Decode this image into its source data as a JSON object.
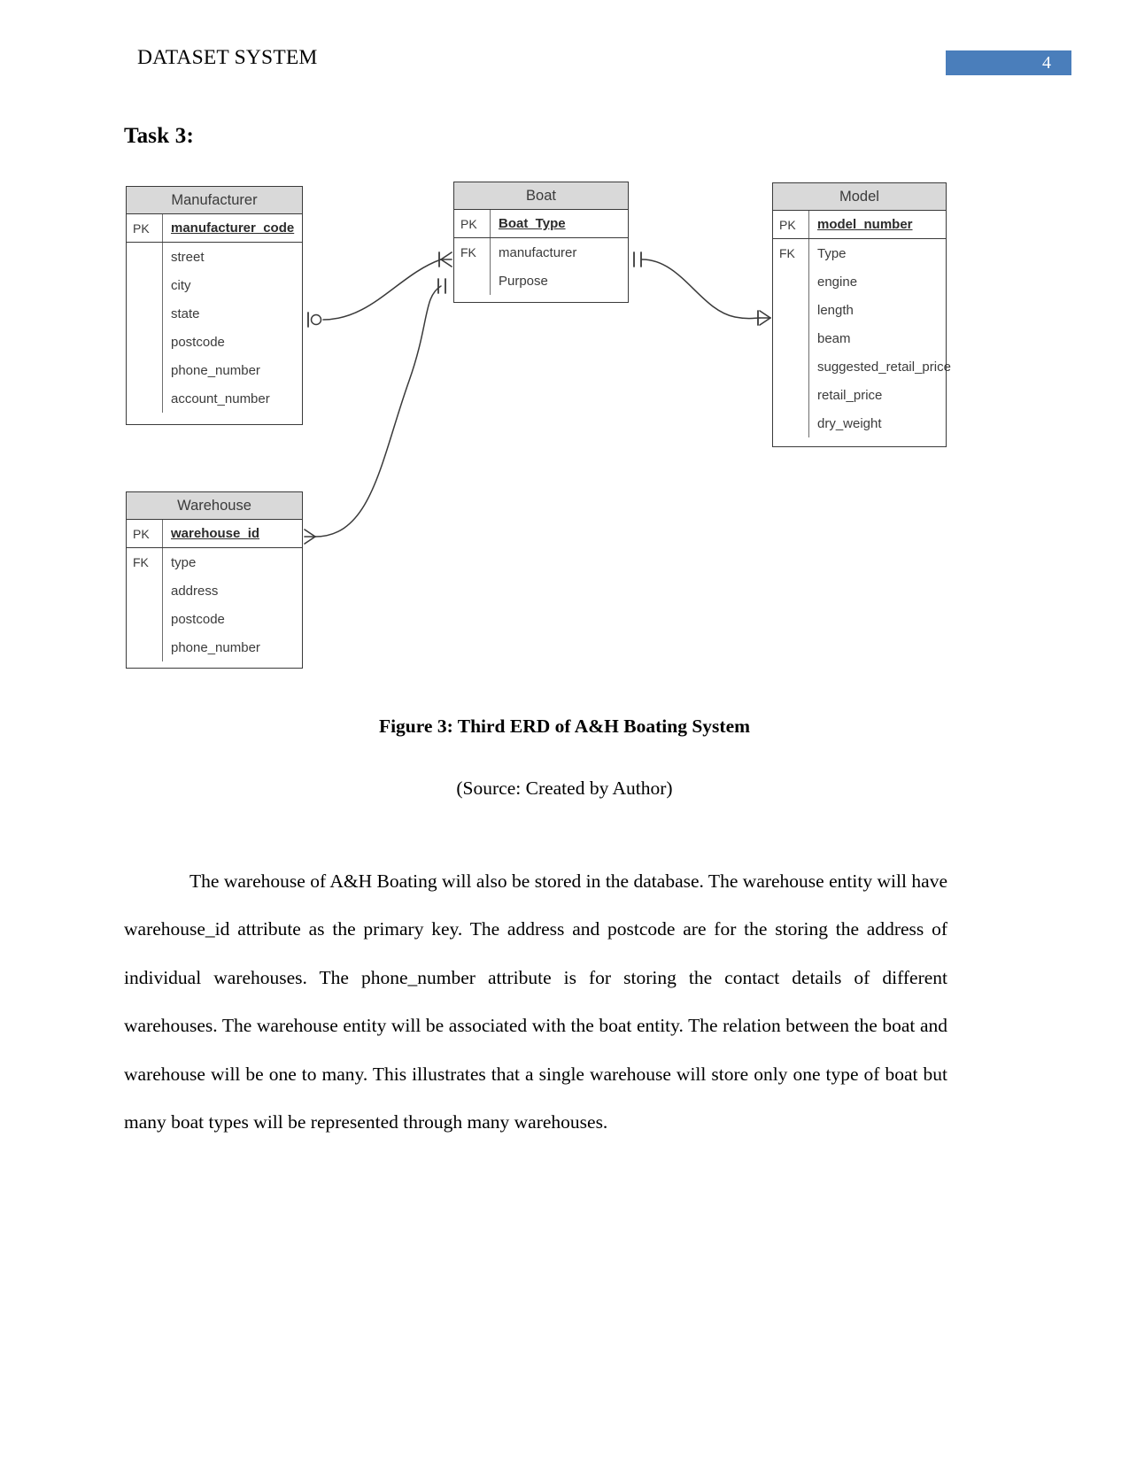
{
  "header": {
    "title": "DATASET SYSTEM",
    "page_number": "4",
    "badge_color": "#4a7ebb"
  },
  "heading": "Task 3:",
  "erd": {
    "entities": [
      {
        "id": "manufacturer",
        "title": "Manufacturer",
        "pk_label": "PK",
        "pk_attr": "manufacturer_code",
        "fk_label": "",
        "attributes": [
          "street",
          "city",
          "state",
          "postcode",
          "phone_number",
          "account_number"
        ]
      },
      {
        "id": "boat",
        "title": "Boat",
        "pk_label": "PK",
        "pk_attr": "Boat_Type",
        "fk_label": "FK",
        "attributes": [
          "manufacturer",
          "Purpose"
        ]
      },
      {
        "id": "model",
        "title": "Model",
        "pk_label": "PK",
        "pk_attr": "model_number",
        "fk_label": "FK",
        "attributes": [
          "Type",
          "engine",
          "length",
          "beam",
          "suggested_retail_price",
          "retail_price",
          "dry_weight"
        ]
      },
      {
        "id": "warehouse",
        "title": "Warehouse",
        "pk_label": "PK",
        "pk_attr": "warehouse_id",
        "fk_label": "FK",
        "attributes": [
          "type",
          "address",
          "postcode",
          "phone_number"
        ]
      }
    ],
    "relationships": [
      {
        "from": "Manufacturer",
        "to": "Boat",
        "from_notation": "one-and-only-one",
        "to_notation": "many"
      },
      {
        "from": "Warehouse",
        "to": "Boat",
        "from_notation": "many",
        "to_notation": "one-and-only-one"
      },
      {
        "from": "Boat",
        "to": "Model",
        "from_notation": "one-and-only-one",
        "to_notation": "many"
      }
    ]
  },
  "figure": {
    "caption": "Figure 3: Third ERD of A&H Boating System",
    "source": "(Source: Created by Author)"
  },
  "body": {
    "paragraph": "The warehouse of A&H Boating will also be stored in the database. The warehouse entity will have warehouse_id attribute as the primary key. The address and postcode are for the storing the address of individual warehouses. The phone_number attribute is for storing the contact details of different warehouses. The warehouse entity will be associated with the boat entity. The relation between the boat and warehouse will be one to many. This illustrates that a single warehouse will store only one type of boat but many boat types will be represented through many warehouses."
  }
}
